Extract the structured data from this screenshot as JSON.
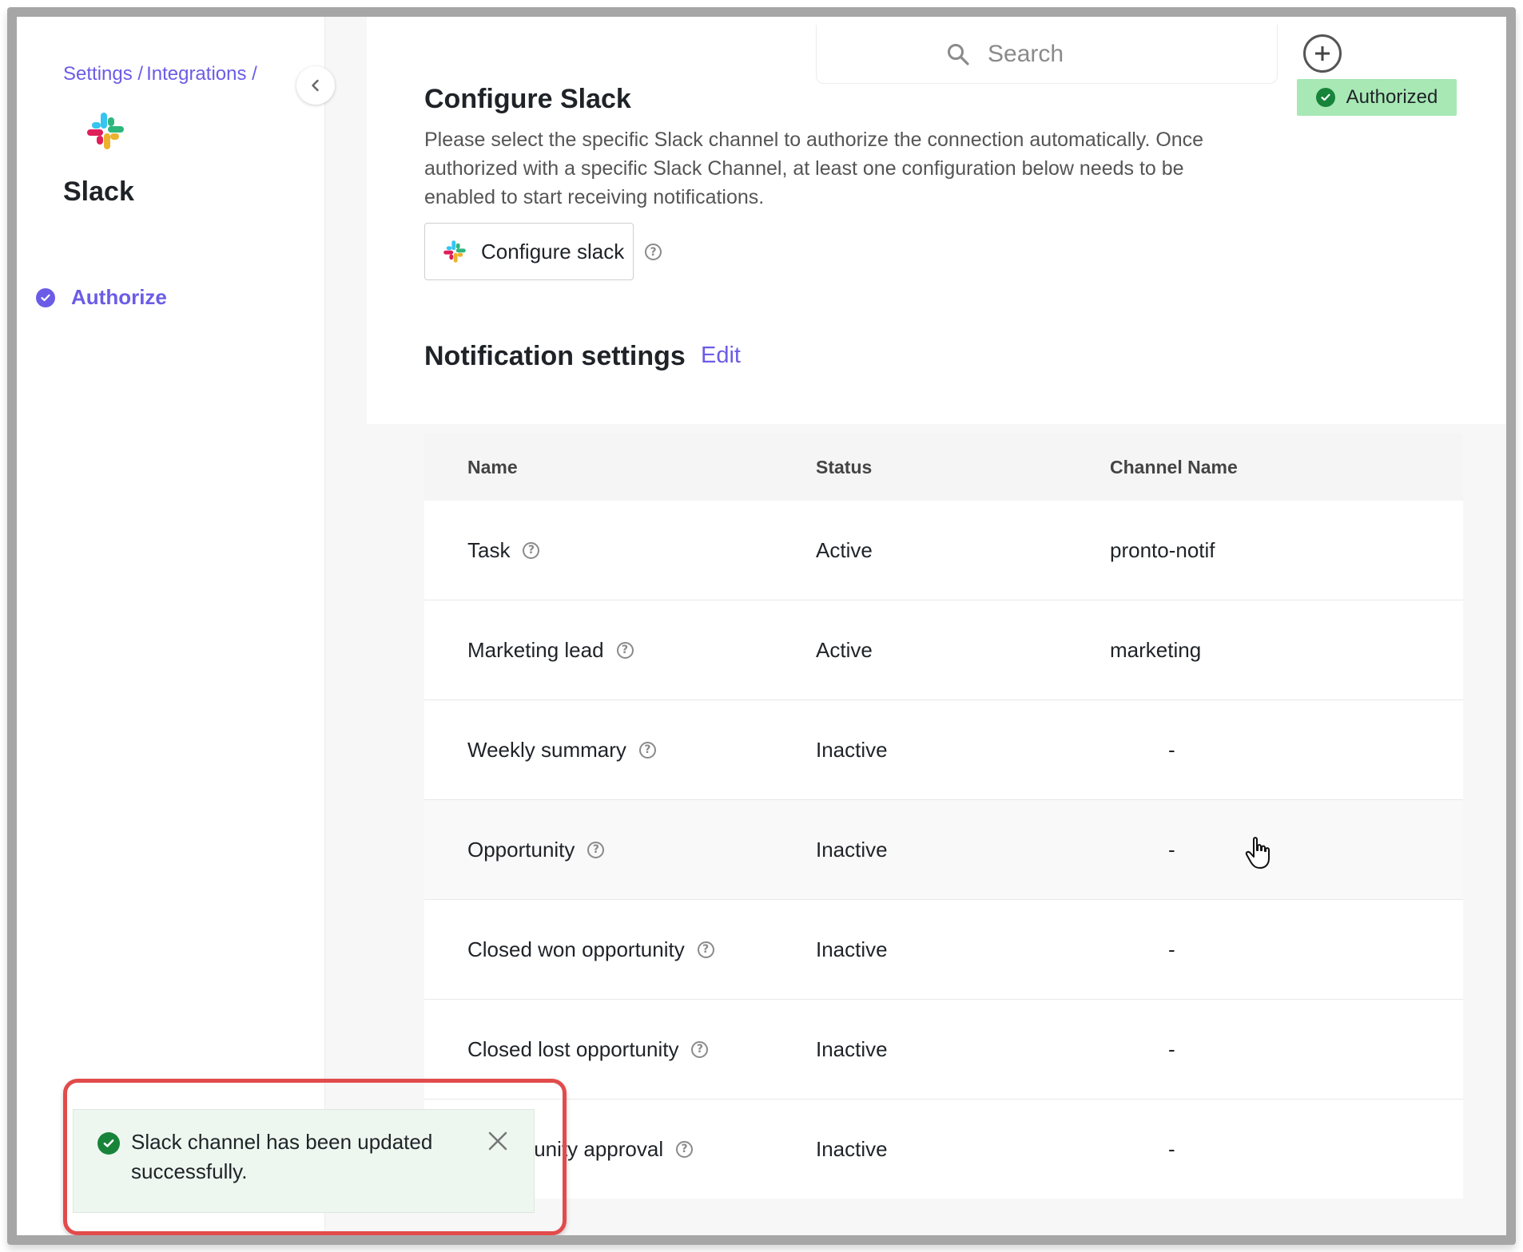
{
  "sidebar": {
    "breadcrumb": [
      "Settings /",
      "Integrations /"
    ],
    "app_name": "Slack",
    "nav_items": [
      {
        "label": "Authorize",
        "completed": true
      }
    ]
  },
  "header": {
    "search_placeholder": "Search",
    "badge_label": "Authorized"
  },
  "configure": {
    "title": "Configure Slack",
    "description": "Please select the specific Slack channel to authorize the connection automatically. Once authorized with a specific Slack Channel, at least one configuration below needs to be enabled to start receiving notifications.",
    "button_label": "Configure slack"
  },
  "notifications": {
    "title": "Notification settings",
    "edit_label": "Edit",
    "columns": [
      "Name",
      "Status",
      "Channel Name"
    ],
    "rows": [
      {
        "name": "Task",
        "status": "Active",
        "channel": "pronto-notif"
      },
      {
        "name": "Marketing lead",
        "status": "Active",
        "channel": "marketing"
      },
      {
        "name": "Weekly summary",
        "status": "Inactive",
        "channel": "-"
      },
      {
        "name": "Opportunity",
        "status": "Inactive",
        "channel": "-"
      },
      {
        "name": "Closed won opportunity",
        "status": "Inactive",
        "channel": "-"
      },
      {
        "name": "Closed lost opportunity",
        "status": "Inactive",
        "channel": "-"
      },
      {
        "name": "tunity approval",
        "status": "Inactive",
        "channel": "-"
      }
    ]
  },
  "toast": {
    "message": "Slack channel has been updated successfully."
  },
  "colors": {
    "accent": "#6b5ce7",
    "success": "#17843a",
    "badge_bg": "#a7e8b4",
    "highlight": "#e24b4b"
  },
  "icons": {
    "search": "search-icon",
    "plus": "plus-circle-icon",
    "collapse": "chevron-left-icon",
    "help": "question-circle-icon",
    "close": "close-icon",
    "check": "check-circle-icon",
    "slack": "slack-logo-icon",
    "cursor": "hand-pointer-icon"
  }
}
